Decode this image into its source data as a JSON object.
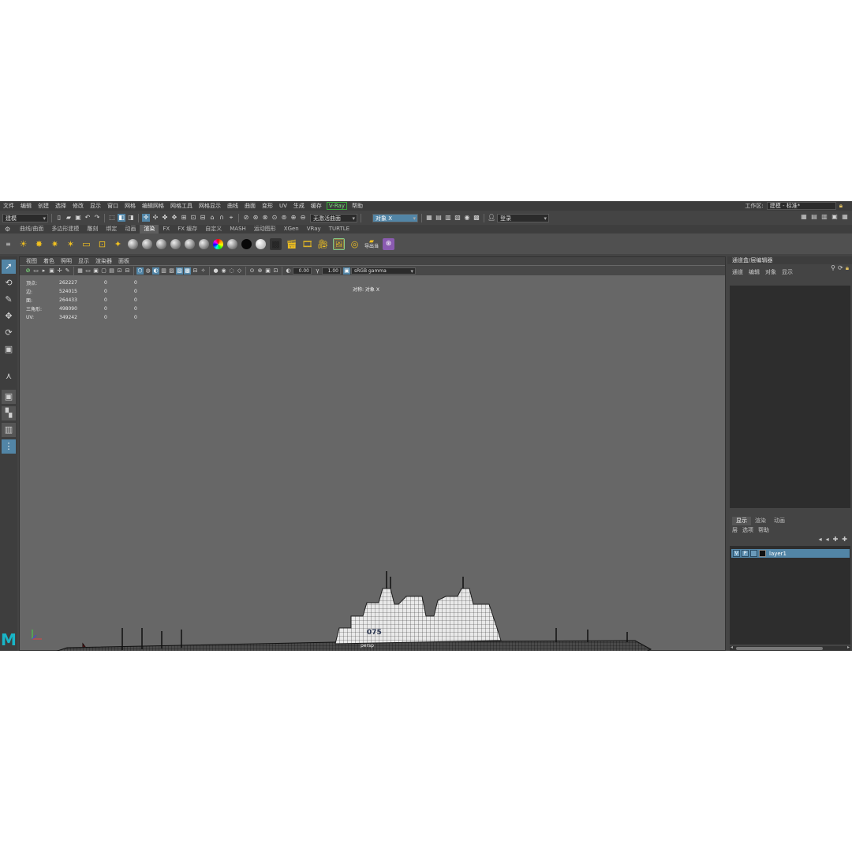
{
  "menu": [
    "文件",
    "编辑",
    "创建",
    "选择",
    "修改",
    "显示",
    "窗口",
    "网格",
    "编辑网格",
    "网格工具",
    "网格显示",
    "曲线",
    "曲面",
    "变形",
    "UV",
    "生成",
    "缓存",
    "V-Ray",
    "帮助"
  ],
  "workspace": {
    "label": "工作区:",
    "value": "建模 - 标准*"
  },
  "status": {
    "mode": "建模",
    "live_surface": "无激活曲面",
    "symmetry": "对象 X",
    "login": "登录"
  },
  "shelf_tabs": [
    "曲线/曲面",
    "多边形建模",
    "雕刻",
    "绑定",
    "动画",
    "渲染",
    "FX",
    "FX 缓存",
    "自定义",
    "MASH",
    "运动图形",
    "XGen",
    "VRay",
    "TURTLE"
  ],
  "shelf_active": "渲染",
  "shelf_export_label": "导出当",
  "viewport": {
    "menu": [
      "视图",
      "着色",
      "照明",
      "显示",
      "渲染器",
      "面板"
    ],
    "exposure": "0.00",
    "gamma": "1.00",
    "colorspace": "sRGB gamma",
    "symmetry_hud": "对称: 对象 X",
    "camera": "persp",
    "hud": [
      {
        "label": "顶点:",
        "v1": "262227",
        "v2": "0",
        "v3": "0"
      },
      {
        "label": "边:",
        "v1": "524015",
        "v2": "0",
        "v3": "0"
      },
      {
        "label": "面:",
        "v1": "264433",
        "v2": "0",
        "v3": "0"
      },
      {
        "label": "三角形:",
        "v1": "498090",
        "v2": "0",
        "v3": "0"
      },
      {
        "label": "UV:",
        "v1": "349242",
        "v2": "0",
        "v3": "0"
      }
    ],
    "hull_number": "075"
  },
  "channel_box": {
    "title": "通道盒/层编辑器",
    "tabs": [
      "通道",
      "编辑",
      "对象",
      "显示"
    ]
  },
  "layer_editor": {
    "tabs": [
      "显示",
      "渲染",
      "动画"
    ],
    "menu": [
      "层",
      "选项",
      "帮助"
    ],
    "layer": {
      "v": "V",
      "p": "P",
      "name": "layer1"
    }
  },
  "colors": {
    "accent": "#5285a6",
    "viewport_bg": "#676767",
    "hull_red": "#6e2020",
    "vray_green": "#3aa83a"
  }
}
